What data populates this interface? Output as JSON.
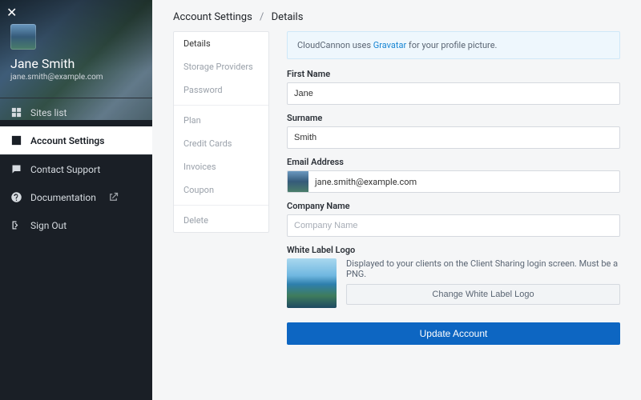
{
  "user": {
    "name": "Jane Smith",
    "email": "jane.smith@example.com"
  },
  "sidebar": {
    "items": [
      {
        "id": "sites-list",
        "label": "Sites list",
        "icon": "grid-icon"
      },
      {
        "id": "account-settings",
        "label": "Account Settings",
        "icon": "user-box-icon",
        "active": true
      },
      {
        "id": "contact-support",
        "label": "Contact Support",
        "icon": "chat-icon"
      },
      {
        "id": "documentation",
        "label": "Documentation",
        "icon": "help-icon",
        "external": true
      },
      {
        "id": "sign-out",
        "label": "Sign Out",
        "icon": "signout-icon"
      }
    ]
  },
  "breadcrumb": {
    "a": "Account Settings",
    "b": "Details"
  },
  "subnav": {
    "groups": [
      [
        "Details",
        "Storage Providers",
        "Password"
      ],
      [
        "Plan",
        "Credit Cards",
        "Invoices",
        "Coupon"
      ],
      [
        "Delete"
      ]
    ],
    "active": "Details"
  },
  "notice": {
    "prefix": "CloudCannon uses ",
    "link_text": "Gravatar",
    "suffix": " for your profile picture."
  },
  "form": {
    "first_name": {
      "label": "First Name",
      "value": "Jane"
    },
    "surname": {
      "label": "Surname",
      "value": "Smith"
    },
    "email": {
      "label": "Email Address",
      "value": "jane.smith@example.com"
    },
    "company": {
      "label": "Company Name",
      "placeholder": "Company Name",
      "value": ""
    },
    "logo": {
      "label": "White Label Logo",
      "hint": "Displayed to your clients on the Client Sharing login screen. Must be a PNG.",
      "change_label": "Change White Label Logo"
    },
    "submit_label": "Update Account"
  }
}
